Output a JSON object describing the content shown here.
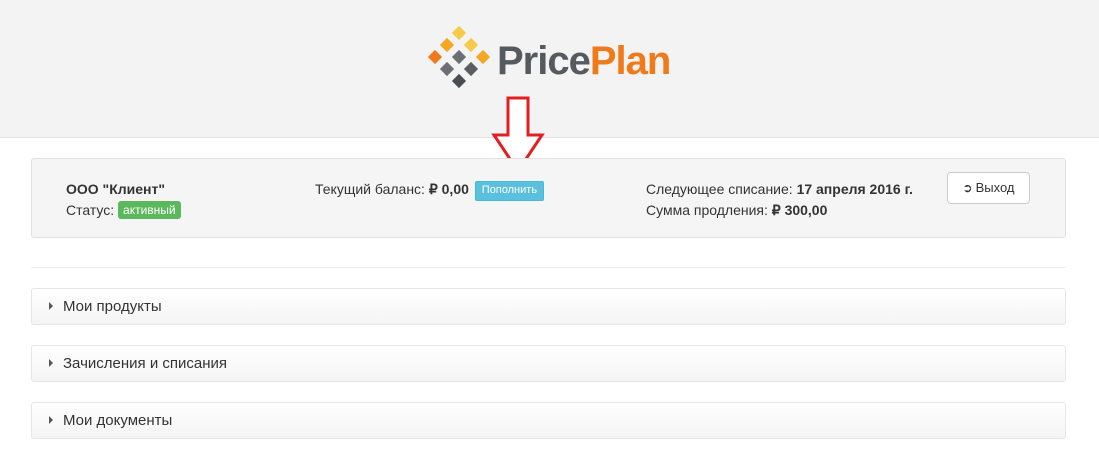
{
  "brand": {
    "part1": "Price",
    "part2": "Plan"
  },
  "account": {
    "client_name": "ООО \"Клиент\"",
    "status_label": "Статус:",
    "status_value": "активный",
    "balance_label": "Текущий баланс:",
    "balance_value": "₽ 0,00",
    "topup_label": "Пополнить",
    "next_charge_label": "Следующее списание:",
    "next_charge_value": "17 апреля 2016 г.",
    "renewal_label": "Сумма продления:",
    "renewal_value": "₽ 300,00",
    "logout_label": "Выход"
  },
  "panels": [
    {
      "title": "Мои продукты"
    },
    {
      "title": "Зачисления и списания"
    },
    {
      "title": "Мои документы"
    }
  ],
  "colors": {
    "status_badge": "#5cb85c",
    "topup_button": "#5bc0de",
    "brand_orange": "#f07a1a",
    "annotation_arrow": "#e02020"
  },
  "icons": {
    "logout": "sign-out-icon",
    "panel_toggle": "caret-right-icon"
  }
}
